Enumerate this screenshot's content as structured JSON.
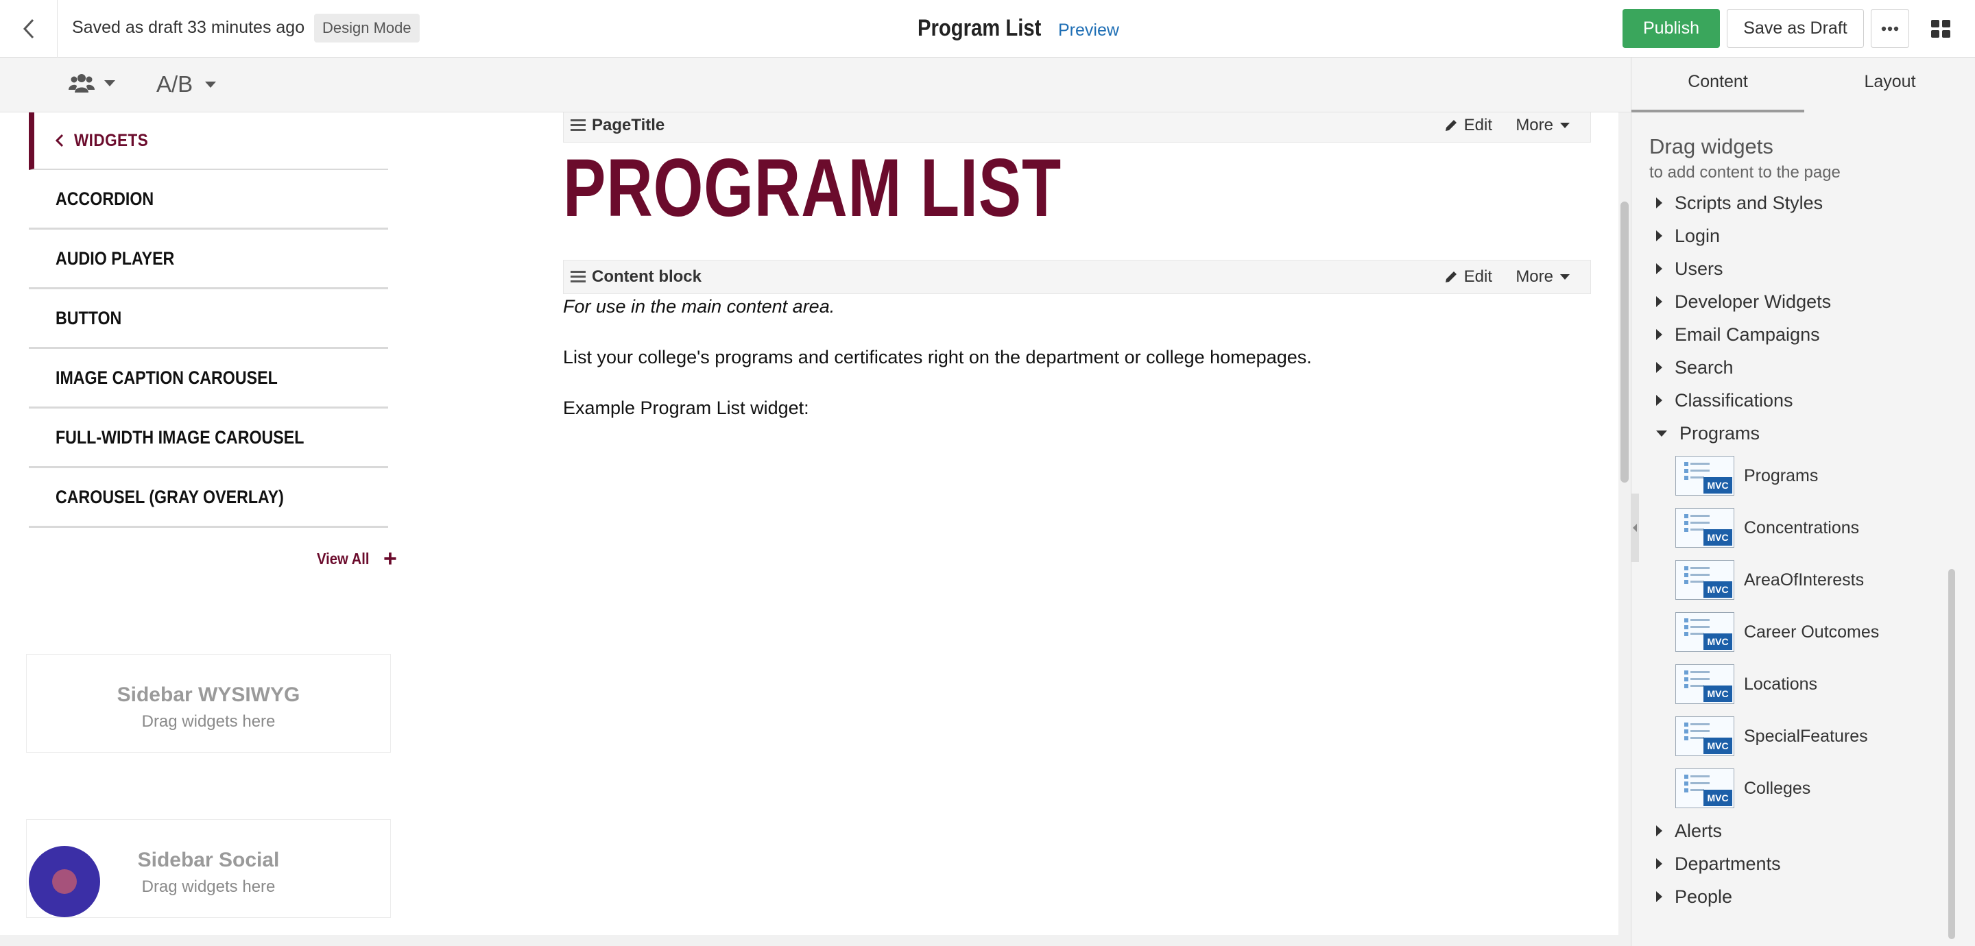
{
  "topbar": {
    "saved_text": "Saved as draft 33 minutes ago",
    "mode_badge": "Design Mode",
    "page_title": "Program List",
    "preview_label": "Preview",
    "publish_label": "Publish",
    "save_draft_label": "Save as Draft"
  },
  "subbar": {
    "ab_label": "A/B"
  },
  "left_widgets": {
    "back_label": "WIDGETS",
    "items": [
      "ACCORDION",
      "AUDIO PLAYER",
      "BUTTON",
      "IMAGE CAPTION CAROUSEL",
      "FULL-WIDTH IMAGE CAROUSEL",
      "CAROUSEL (GRAY OVERLAY)"
    ],
    "view_all_label": "View All"
  },
  "dropzones": [
    {
      "title": "Sidebar WYSIWYG",
      "sub": "Drag widgets here"
    },
    {
      "title": "Sidebar Social",
      "sub": "Drag widgets here"
    }
  ],
  "blocks": {
    "page_title_widget": "PageTitle",
    "content_block_widget": "Content block",
    "edit_label": "Edit",
    "more_label": "More",
    "hero_title": "PROGRAM LIST",
    "para1": "For use in the main content area.",
    "para2": "List your college's programs and certificates right on the department or college homepages.",
    "para3": "Example Program List widget:"
  },
  "right_panel": {
    "tabs": [
      "Content",
      "Layout"
    ],
    "drag_title": "Drag widgets",
    "drag_sub": "to add content to the page",
    "categories_before": [
      "Scripts and Styles",
      "Login",
      "Users",
      "Developer Widgets",
      "Email Campaigns",
      "Search",
      "Classifications"
    ],
    "expanded_category": "Programs",
    "program_widgets": [
      "Programs",
      "Concentrations",
      "AreaOfInterests",
      "Career Outcomes",
      "Locations",
      "SpecialFeatures",
      "Colleges"
    ],
    "mvc_badge": "MVC",
    "categories_after": [
      "Alerts",
      "Departments",
      "People"
    ]
  },
  "colors": {
    "brand": "#6b0b2c",
    "publish": "#3aa65c",
    "link": "#1f6fb5",
    "mvc": "#1c5fa8"
  }
}
